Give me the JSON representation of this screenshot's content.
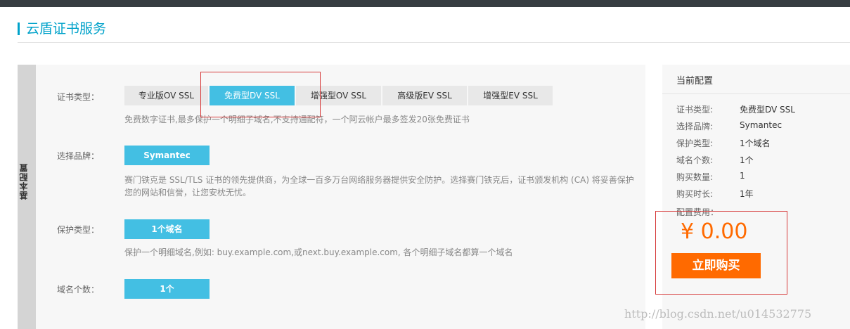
{
  "header": {
    "title": "云盾证书服务"
  },
  "side_tab": {
    "label": "基本配置"
  },
  "cert_type": {
    "label": "证书类型：",
    "options": [
      "专业版OV SSL",
      "免费型DV SSL",
      "增强型OV SSL",
      "高级版EV SSL",
      "增强型EV SSL"
    ],
    "selected": "免费型DV SSL",
    "description": "免费数字证书,最多保护一个明细子域名,不支持通配符，一个阿云帐户最多签发20张免费证书"
  },
  "brand": {
    "label": "选择品牌：",
    "value": "Symantec",
    "description_line1": "赛门铁克是 SSL/TLS 证书的领先提供商，为全球一百多万台网络服务器提供安全防护。选择赛门铁克后，证书颁发机构 (CA) 将妥善保护",
    "description_line2": "您的网站和信誉，让您安枕无忧。"
  },
  "protect_type": {
    "label": "保护类型：",
    "value": "1个域名",
    "description": "保护一个明细域名,例如: buy.example.com,或next.buy.example.com, 各个明细子域名都算一个域名"
  },
  "domain_count": {
    "label": "域名个数：",
    "value": "1个"
  },
  "summary": {
    "title": "当前配置",
    "rows": [
      {
        "key": "证书类型:",
        "value": "免费型DV SSL"
      },
      {
        "key": "选择品牌:",
        "value": "Symantec"
      },
      {
        "key": "保护类型:",
        "value": "1个域名"
      },
      {
        "key": "域名个数:",
        "value": "1个"
      },
      {
        "key": "购买数量:",
        "value": "1"
      },
      {
        "key": "购买时长:",
        "value": "1年"
      }
    ],
    "fee_label": "配置费用：",
    "price": "¥ 0.00",
    "buy_label": "立即购买"
  },
  "colors": {
    "accent": "#43bfe3",
    "title": "#00a2ca",
    "price": "#ff6a00",
    "highlight": "#d63a3a"
  },
  "watermark": "http://blog.csdn.net/u014532775"
}
